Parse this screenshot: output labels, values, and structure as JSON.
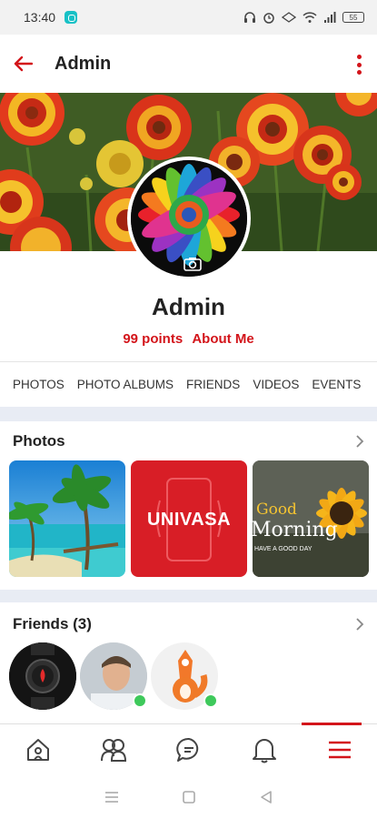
{
  "status_bar": {
    "time": "13:40",
    "battery": "55"
  },
  "header": {
    "title": "Admin"
  },
  "profile": {
    "name": "Admin",
    "points": "99 points",
    "about": "About Me"
  },
  "tabs": [
    "PHOTOS",
    "PHOTO ALBUMS",
    "FRIENDS",
    "VIDEOS",
    "EVENTS"
  ],
  "photos_section": {
    "title": "Photos",
    "items": [
      {
        "name": "beach-palm-photo"
      },
      {
        "name": "univasa-photo",
        "text": "UNIVASA"
      },
      {
        "name": "good-morning-photo",
        "line1": "Good",
        "line2": "Morning",
        "line3": "HAVE A GOOD DAY"
      }
    ]
  },
  "friends_section": {
    "title": "Friends (3)"
  },
  "bottom_nav": [
    "home-icon",
    "friends-icon",
    "messages-icon",
    "notifications-icon",
    "menu-icon"
  ],
  "colors": {
    "accent": "#d3141a",
    "online": "#3ec95b",
    "section_gap": "#e8ecf4"
  }
}
